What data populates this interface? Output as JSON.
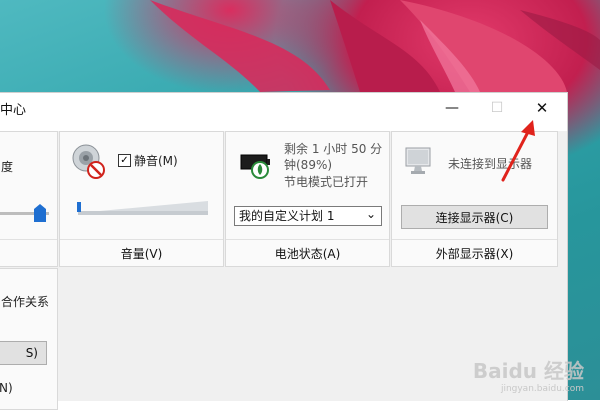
{
  "window": {
    "title": "中心",
    "minimize_glyph": "—",
    "maximize_glyph": "☐",
    "close_glyph": "✕"
  },
  "left_partial": {
    "brightness_label": "度",
    "brightness_level_pct": 100,
    "sync_text": "合作关系",
    "button_text": "S)",
    "footer_text": "N)"
  },
  "volume": {
    "mute_label": "静音(M)",
    "mute_checked": true,
    "check_glyph": "✓",
    "level_pct": 0,
    "footer": "音量(V)"
  },
  "battery": {
    "line1": "剩余 1 小时 50 分",
    "line2": "钟(89%)",
    "line3": "节电模式已打开",
    "plan_selected": "我的自定义计划 1",
    "dropdown_glyph": "⌄",
    "footer": "电池状态(A)"
  },
  "display": {
    "status": "未连接到显示器",
    "connect_button": "连接显示器(C)",
    "footer": "外部显示器(X)"
  },
  "watermark": {
    "brand": "Baidu 经验",
    "url": "jingyan.baidu.com"
  },
  "colors": {
    "accent_blue": "#1f6fd1",
    "annotation_red": "#e0231c"
  }
}
